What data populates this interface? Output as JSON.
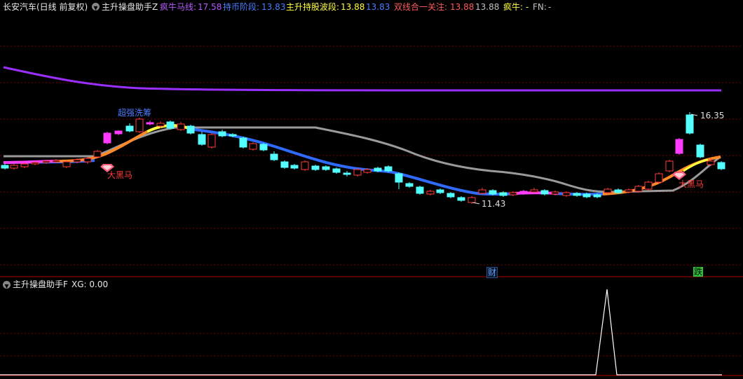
{
  "header": {
    "stock_name": "长安汽车",
    "period_label": "(日线 前复权)",
    "indicator_name": "主升操盘助手Z",
    "values": [
      {
        "label": "疯牛马线: ",
        "value": "17.58",
        "color": "#b25cff"
      },
      {
        "label": "持币阶段: ",
        "value": "13.83",
        "color": "#4a7dff"
      },
      {
        "label": "主升持股波段: ",
        "value": "13.88",
        "color": "#ffff3c"
      },
      {
        "label": "13.83",
        "value": "",
        "color": "#4a7dff"
      },
      {
        "label": "双线合一关注: ",
        "value": "13.88",
        "color": "#ff5a5a"
      },
      {
        "label": "13.88",
        "value": "",
        "color": "#c0c0c0"
      },
      {
        "label": "疯牛: ",
        "value": "-",
        "color": "#ffff3c"
      },
      {
        "label": "FN: ",
        "value": "-",
        "color": "#c0c0c0"
      }
    ]
  },
  "annotations": {
    "wash": "超强洗筹",
    "horse1": "大黑马",
    "horse2": "大黑马",
    "high": "16.35",
    "low": "11.43"
  },
  "badges": {
    "cai": "财",
    "die": "跌"
  },
  "lower_panel": {
    "indicator_name": "主升操盘助手F",
    "value_label": "XG: 0.00"
  },
  "colors": {
    "up": "#ff3c3c",
    "down": "#54ffff",
    "ma_purple": "#9a2fff",
    "ma_blue": "#2f6bff",
    "ma_gray": "#9a9a9a",
    "grid": "#7a0000"
  }
}
